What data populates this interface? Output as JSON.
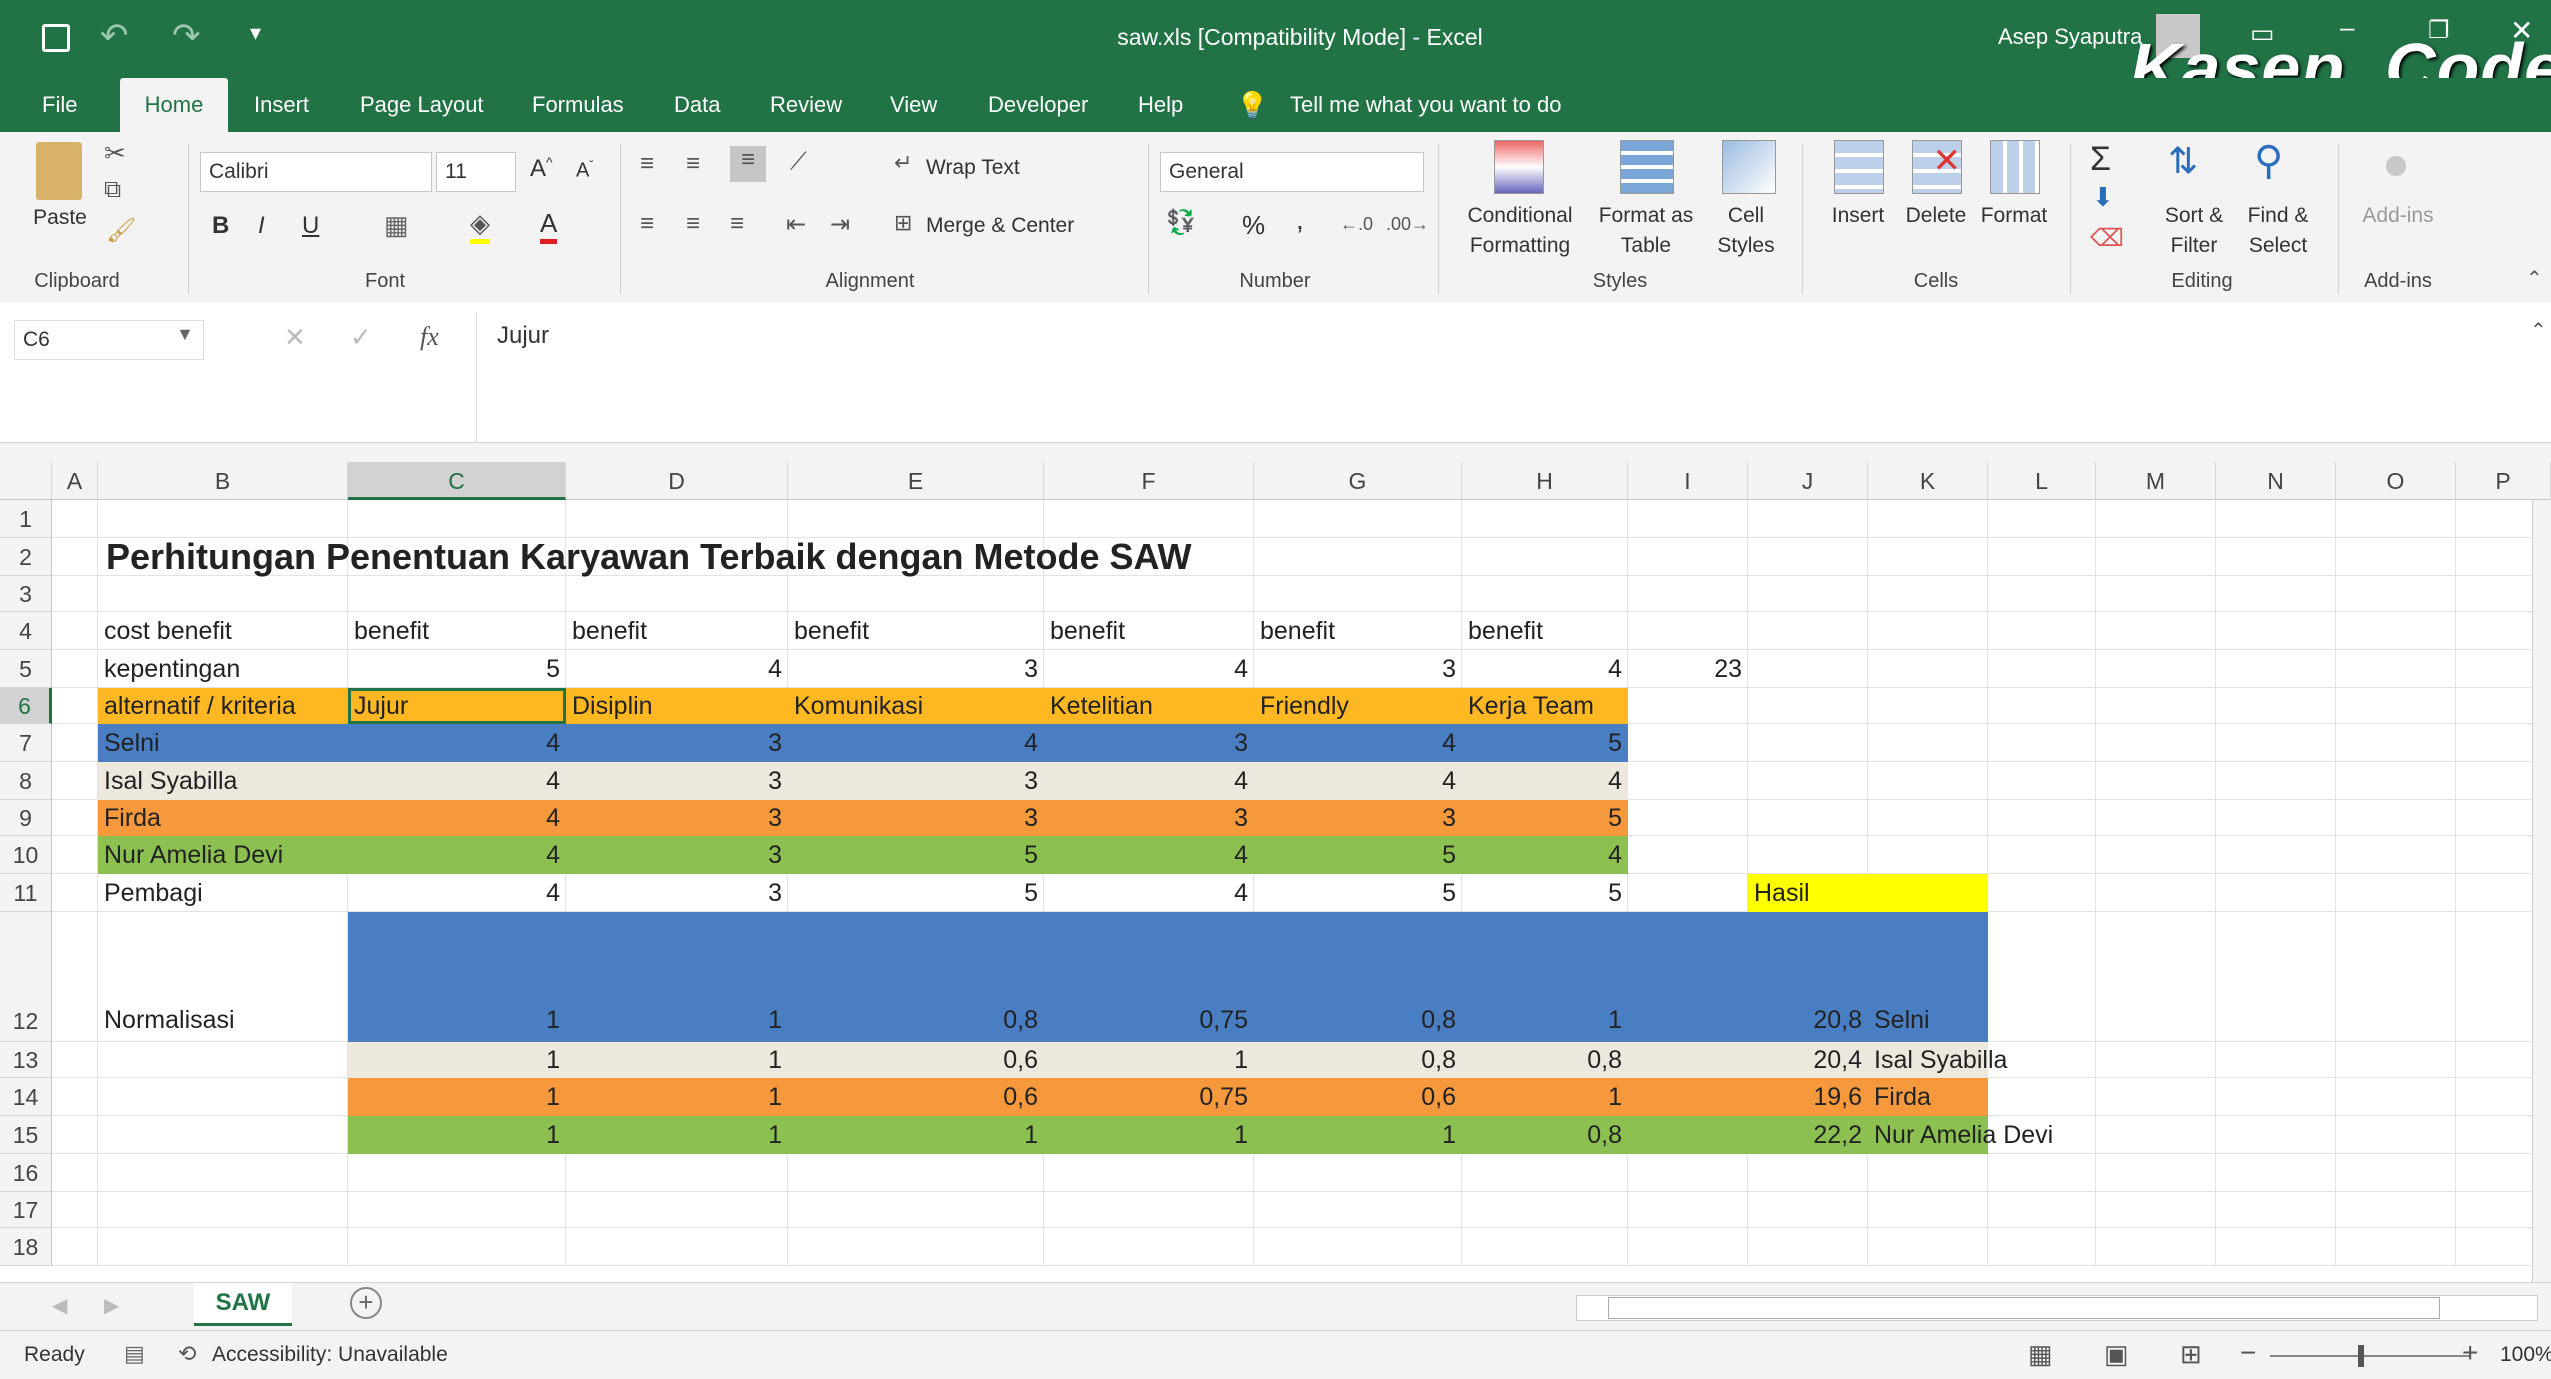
{
  "window": {
    "title": "saw.xls  [Compatibility Mode]  -  Excel",
    "user": "Asep Syaputra",
    "watermark": "Kasep_Code"
  },
  "tabs": [
    "File",
    "Home",
    "Insert",
    "Page Layout",
    "Formulas",
    "Data",
    "Review",
    "View",
    "Developer",
    "Help"
  ],
  "tell_me": "Tell me what you want to do",
  "ribbon": {
    "clipboard": {
      "paste": "Paste",
      "label": "Clipboard"
    },
    "font": {
      "name": "Calibri",
      "size": "11",
      "label": "Font",
      "bold": "B",
      "italic": "I",
      "underline": "U"
    },
    "alignment": {
      "wrap": "Wrap Text",
      "merge": "Merge & Center",
      "label": "Alignment"
    },
    "number": {
      "format": "General",
      "label": "Number",
      "percent": "%",
      "comma": ","
    },
    "styles": {
      "conditional": "Conditional",
      "conditional2": "Formatting",
      "format_table": "Format as",
      "format_table2": "Table",
      "cell_styles": "Cell",
      "cell_styles2": "Styles",
      "label": "Styles"
    },
    "cells": {
      "insert": "Insert",
      "delete": "Delete",
      "format": "Format",
      "label": "Cells"
    },
    "editing": {
      "sort": "Sort &",
      "sort2": "Filter",
      "find": "Find &",
      "find2": "Select",
      "label": "Editing"
    },
    "addins": {
      "addins": "Add-ins",
      "label": "Add-ins"
    }
  },
  "formula_bar": {
    "name_box": "C6",
    "formula": "Jujur",
    "fx": "fx"
  },
  "columns": [
    "A",
    "B",
    "C",
    "D",
    "E",
    "F",
    "G",
    "H",
    "I",
    "J",
    "K",
    "L",
    "M",
    "N",
    "O",
    "P"
  ],
  "rows": [
    "1",
    "2",
    "3",
    "4",
    "5",
    "6",
    "7",
    "8",
    "9",
    "10",
    "11",
    "12",
    "13",
    "14",
    "15",
    "16",
    "17",
    "18"
  ],
  "sheet": {
    "title": "Perhitungan Penentuan Karyawan Terbaik dengan Metode SAW",
    "r4": [
      "cost benefit",
      "benefit",
      "benefit",
      "benefit",
      "benefit",
      "benefit",
      "benefit"
    ],
    "r5": {
      "label": "kepentingan",
      "vals": [
        "5",
        "4",
        "3",
        "4",
        "3",
        "4"
      ],
      "total": "23"
    },
    "r6": [
      "alternatif / kriteria",
      "Jujur",
      "Disiplin",
      "Komunikasi",
      "Ketelitian",
      "Friendly",
      "Kerja Team"
    ],
    "r7": {
      "label": "Selni",
      "vals": [
        "4",
        "3",
        "4",
        "3",
        "4",
        "5"
      ]
    },
    "r8": {
      "label": "Isal Syabilla",
      "vals": [
        "4",
        "3",
        "3",
        "4",
        "4",
        "4"
      ]
    },
    "r9": {
      "label": "Firda",
      "vals": [
        "4",
        "3",
        "3",
        "3",
        "3",
        "5"
      ]
    },
    "r10": {
      "label": "Nur Amelia Devi",
      "vals": [
        "4",
        "3",
        "5",
        "4",
        "5",
        "4"
      ]
    },
    "r11": {
      "label": "Pembagi",
      "vals": [
        "4",
        "3",
        "5",
        "4",
        "5",
        "5"
      ],
      "hasil": "Hasil"
    },
    "r12": {
      "label": "Normalisasi",
      "vals": [
        "1",
        "1",
        "0,8",
        "0,75",
        "0,8",
        "1"
      ],
      "score": "20,8",
      "name": "Selni"
    },
    "r13": {
      "vals": [
        "1",
        "1",
        "0,6",
        "1",
        "0,8",
        "0,8"
      ],
      "score": "20,4",
      "name": "Isal Syabilla"
    },
    "r14": {
      "vals": [
        "1",
        "1",
        "0,6",
        "0,75",
        "0,6",
        "1"
      ],
      "score": "19,6",
      "name": "Firda"
    },
    "r15": {
      "vals": [
        "1",
        "1",
        "1",
        "1",
        "1",
        "0,8"
      ],
      "score": "22,2",
      "name": "Nur Amelia Devi"
    }
  },
  "sheet_tab": "SAW",
  "status": {
    "ready": "Ready",
    "accessibility": "Accessibility: Unavailable",
    "zoom": "100%"
  },
  "colors": {
    "excel_green": "#217346",
    "blue": "#4a7ec2",
    "orange": "#f5993c",
    "green": "#8cc152",
    "gold": "#ffb822",
    "yellow": "#ffff00",
    "beige": "#ede8dd"
  }
}
